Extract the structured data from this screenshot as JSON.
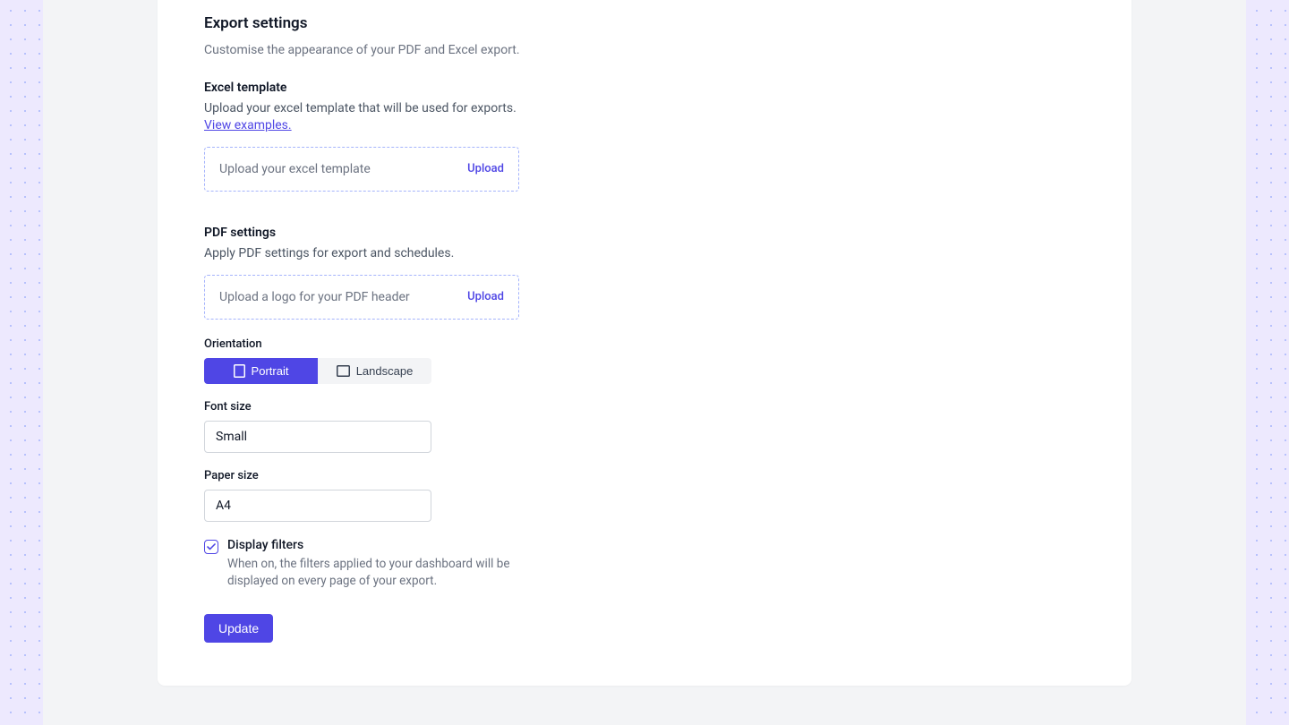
{
  "export": {
    "title": "Export settings",
    "desc": "Customise the appearance of your PDF and Excel export."
  },
  "excel": {
    "title": "Excel template",
    "desc": "Upload your excel template that will be used for exports. ",
    "link": "View examples.",
    "upload_placeholder": "Upload your excel template",
    "upload_label": "Upload"
  },
  "pdf": {
    "title": "PDF settings",
    "desc": "Apply PDF settings for export and schedules.",
    "upload_placeholder": "Upload a logo for your PDF header",
    "upload_label": "Upload",
    "orientation_label": "Orientation",
    "orientation_portrait": "Portrait",
    "orientation_landscape": "Landscape",
    "fontsize_label": "Font size",
    "fontsize_value": "Small",
    "papersize_label": "Paper size",
    "papersize_value": "A4",
    "display_filters_label": "Display filters",
    "display_filters_desc": "When on, the filters applied to your dashboard will be displayed on every page of your export."
  },
  "update_label": "Update"
}
